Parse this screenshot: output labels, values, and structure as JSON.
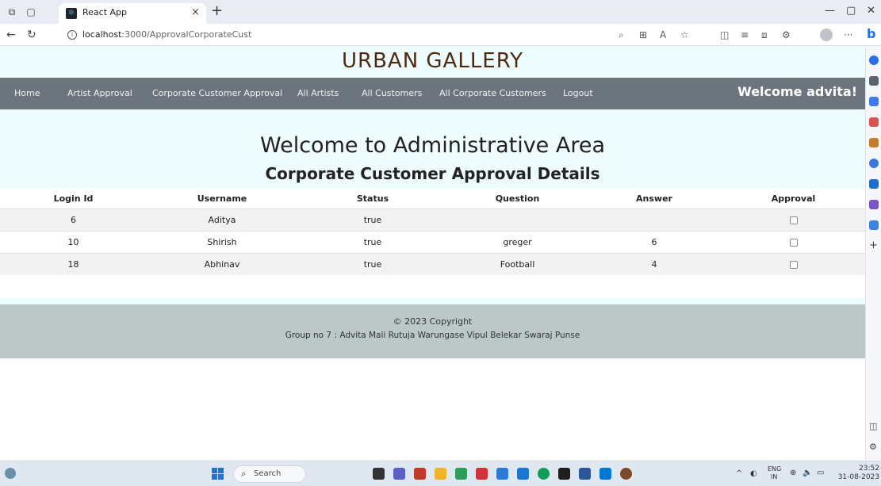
{
  "browser": {
    "tab_title": "React App",
    "tab_close": "×",
    "new_tab": "+",
    "url_host": "localhost",
    "url_path": ":3000/ApprovalCorporateCust",
    "more": "···"
  },
  "brand": "URBAN GALLERY",
  "nav": {
    "items": [
      {
        "label": "Home"
      },
      {
        "label": "Artist Approval"
      },
      {
        "label": "Corporate Customer Approval"
      },
      {
        "label": "All Artists"
      },
      {
        "label": "All Customers"
      },
      {
        "label": "All Corporate Customers"
      },
      {
        "label": "Logout"
      }
    ],
    "welcome": "Welcome advita!"
  },
  "hero": {
    "title": "Welcome to Administrative Area",
    "subtitle": "Corporate Customer Approval Details"
  },
  "table": {
    "headers": [
      "Login Id",
      "Username",
      "Status",
      "Question",
      "Answer",
      "Approval"
    ],
    "rows": [
      {
        "login_id": "6",
        "username": "Aditya",
        "status": "true",
        "question": "",
        "answer": "",
        "approved": false
      },
      {
        "login_id": "10",
        "username": "Shirish",
        "status": "true",
        "question": "greger",
        "answer": "6",
        "approved": false
      },
      {
        "login_id": "18",
        "username": "Abhinav",
        "status": "true",
        "question": "Football",
        "answer": "4",
        "approved": false
      }
    ]
  },
  "footer": {
    "copyright": "© 2023 Copyright",
    "group": "Group no 7 : Advita Mali Rutuja Warungase Vipul Belekar Swaraj Punse"
  },
  "taskbar": {
    "search_label": "Search",
    "lang": "ENG",
    "region": "IN",
    "time": "23:52",
    "date": "31-08-2023"
  },
  "colors": {
    "page_bg": "#effcfd",
    "navbar_bg": "#6c757d",
    "brand_text": "#4a2a10",
    "footer_bg": "#bcc8c8"
  }
}
